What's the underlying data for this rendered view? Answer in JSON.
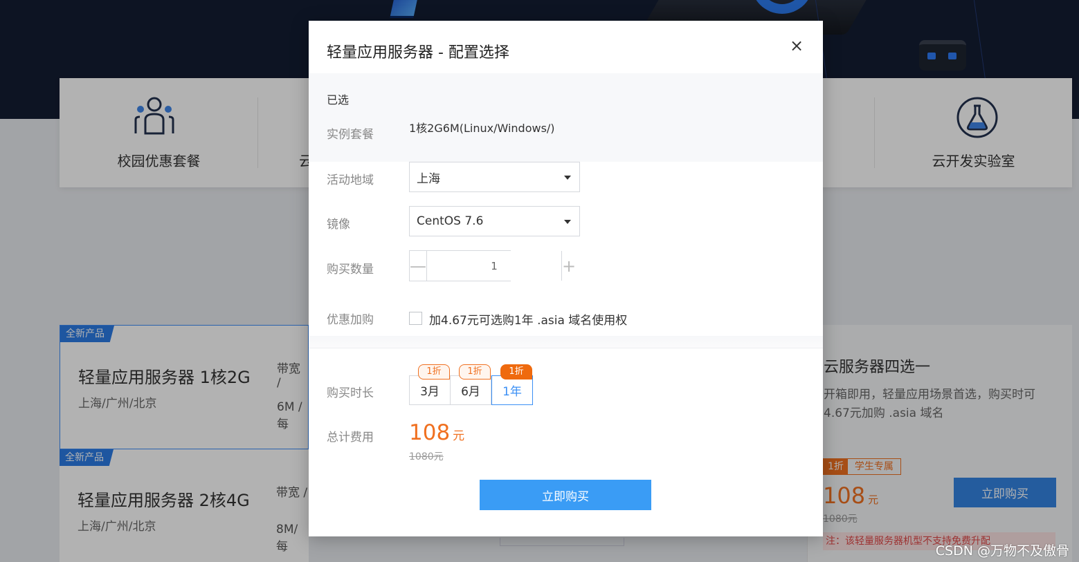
{
  "categories": [
    {
      "label": "校园优惠套餐",
      "icon": "people-icon"
    },
    {
      "label": "云",
      "icon": ""
    },
    {
      "label": "云开发实验室",
      "icon": "flask-icon"
    }
  ],
  "products": [
    {
      "tag": "全新产品",
      "name": "轻量应用服务器 1核2G",
      "regions": "上海/广州/北京",
      "bandwidth_label": "带宽 /",
      "bandwidth_value": "6M / 每"
    },
    {
      "tag": "全新产品",
      "name": "轻量应用服务器 2核4G",
      "regions": "上海/广州/北京",
      "bandwidth_label": "带宽 /",
      "bandwidth_value": "8M/每"
    }
  ],
  "right_card": {
    "title": "云服务器四选一",
    "desc_line1": "开箱即用，轻量应用场景首选，购买时可",
    "desc_line2": "4.67元加购 .asia 域名",
    "discount": "1折",
    "student": "学生专属",
    "price": "108",
    "unit": "元",
    "original": "1080元",
    "buy": "立即购买",
    "note": "注：该轻量服务器机型不支持免费升配"
  },
  "watermark": "CSDN @万物不及傲骨",
  "modal": {
    "title": "轻量应用服务器 - 配置选择",
    "close": "×",
    "selected_title": "已选",
    "instance_label": "实例套餐",
    "instance_value": "1核2G6M(Linux/Windows/)",
    "region_label": "活动地域",
    "region_value": "上海",
    "image_label": "镜像",
    "image_value": "CentOS 7.6",
    "qty_label": "购买数量",
    "qty_minus": "—",
    "qty_value": "1",
    "qty_plus": "+",
    "addon_label": "优惠加购",
    "addon_text": "加4.67元可选购1年 .asia 域名使用权",
    "addon_checked": false,
    "duration_label": "购买时长",
    "durations": [
      {
        "label": "3月",
        "tag": "1折",
        "active": false
      },
      {
        "label": "6月",
        "tag": "1折",
        "active": false
      },
      {
        "label": "1年",
        "tag": "1折",
        "active": true
      }
    ],
    "total_label": "总计费用",
    "total_price": "108",
    "total_unit": "元",
    "total_original": "1080元",
    "buy_label": "立即购买"
  },
  "colors": {
    "accent": "#3a9cf5",
    "price": "#f07020",
    "hero_bg": "#141d33",
    "tag_blue": "#2c7be5"
  }
}
